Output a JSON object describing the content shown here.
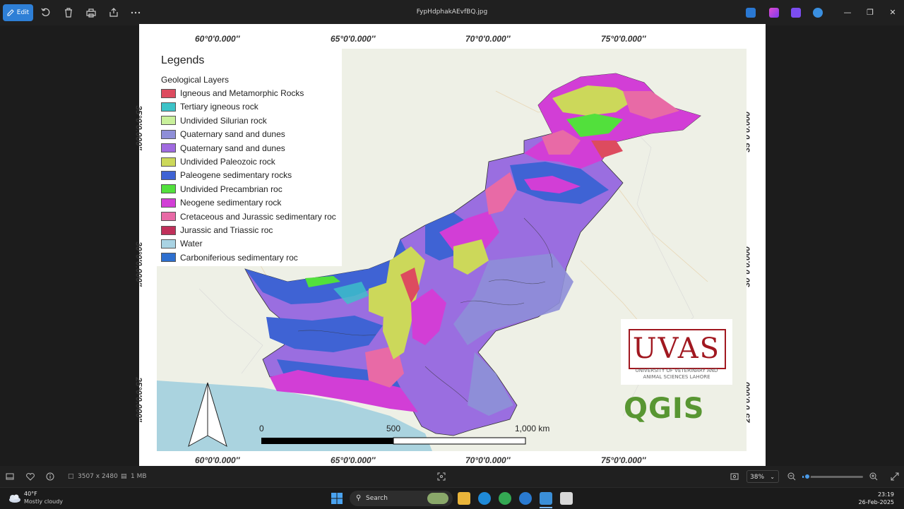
{
  "titlebar": {
    "edit_label": "Edit",
    "filename": "FypHdphakAEvfBQ.jpg"
  },
  "map": {
    "top_coords": [
      "60°0′0.000″",
      "65°0′0.000″",
      "70°0′0.000″",
      "75°0′0.000″"
    ],
    "bottom_coords": [
      "60°0′0.000″",
      "65°0′0.000″",
      "70°0′0.000″",
      "75°0′0.000″"
    ],
    "left_coords": [
      "35°0′0.000″",
      "30°0′0.000″",
      "25°0′0.000″"
    ],
    "right_coords": [
      "35°0′0.000″",
      "30°0′0.000″",
      "25°0′0.000″"
    ],
    "legend": {
      "title": "Legends",
      "subtitle": "Geological Layers",
      "items": [
        {
          "label": "Igneous and Metamorphic Rocks",
          "color": "#dd4b5f"
        },
        {
          "label": "Tertiary igneous rock",
          "color": "#3cc3c8"
        },
        {
          "label": "Undivided Silurian rock",
          "color": "#c9f09b"
        },
        {
          "label": "Quaternary sand and dunes",
          "color": "#8e8ed8"
        },
        {
          "label": "Quaternary sand and dunes",
          "color": "#a06ae0"
        },
        {
          "label": "Undivided Paleozoic rock",
          "color": "#ccd85a"
        },
        {
          "label": "Paleogene sedimentary rocks",
          "color": "#3f63d4"
        },
        {
          "label": "Undivided Precambrian roc",
          "color": "#52e03c"
        },
        {
          "label": "Neogene sedimentary rock",
          "color": "#d23ed6"
        },
        {
          "label": "Cretaceous and Jurassic sedimentary roc",
          "color": "#e86aa6"
        },
        {
          "label": "Jurassic and Triassic roc",
          "color": "#c0305a"
        },
        {
          "label": "Water",
          "color": "#a9d3e3"
        },
        {
          "label": "Carboniferious sedimentary roc",
          "color": "#2d6fcf"
        }
      ]
    },
    "scale": {
      "zero": "0",
      "mid": "500",
      "end": "1,000 km"
    },
    "uvas": {
      "name": "UVAS",
      "subtitle_line1": "UNIVERSITY OF VETERINARY AND",
      "subtitle_line2": "ANIMAL SCIENCES LAHORE"
    },
    "qgis": "QGIS"
  },
  "statusbar": {
    "dimensions": "3507 x 2480",
    "filesize": "1 MB",
    "zoom": "38%",
    "zoom_level": 0.08
  },
  "taskbar": {
    "temperature": "40°F",
    "weather": "Mostly cloudy",
    "search_label": "Search",
    "time": "23:19",
    "date": "26-Feb-2025"
  }
}
